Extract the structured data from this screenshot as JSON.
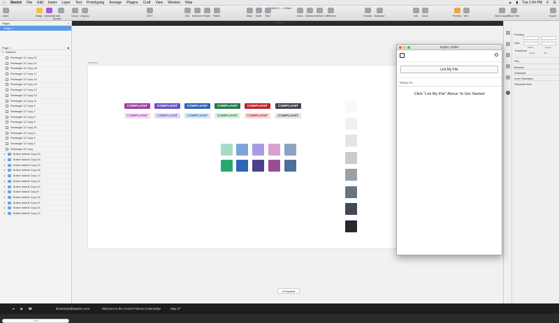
{
  "menubar": {
    "app": "Sketch",
    "items": [
      "File",
      "Edit",
      "Insert",
      "Layer",
      "Text",
      "Prototyping",
      "Arrange",
      "Plugins",
      "Craft",
      "View",
      "Window",
      "Help"
    ],
    "clock": "Tue 1:54 PM"
  },
  "toolbar": {
    "doc_title": "Untitled 6 — Edited",
    "items": [
      "Insert",
      "Shape",
      "Symbols",
      "Create Symbol",
      "Group",
      "Ungroup",
      "Zoom",
      "Edit",
      "Transform",
      "Rotate",
      "Flatten",
      "Mask",
      "Scale",
      "Slice",
      "Union",
      "Subtract",
      "Intersect",
      "Difference",
      "Forward",
      "Backward",
      "Link",
      "Cloud",
      "Preview",
      "View",
      "Show Layout",
      "Show Grid",
      "Export"
    ],
    "zoom": "124%"
  },
  "canvas_title": "Untitled 6",
  "pages": {
    "header": "Pages",
    "selected": "Page 1",
    "layers_header": "Page 1",
    "artboard": "Artboard",
    "layers": [
      "Rectangle 12 Copy 20",
      "Rectangle 12 Copy 19",
      "Rectangle 12 Copy 18",
      "Rectangle 12 Copy 17",
      "Rectangle 12 Copy 16",
      "Rectangle 12 Copy 15",
      "Rectangle 12 Copy 14",
      "Rectangle 12 Copy 13",
      "Rectangle 12 Copy 11",
      "Rectangle 12 Copy 9",
      "Rectangle 12 Copy 7",
      "Rectangle 12 Copy 5",
      "Rectangle 12 Copy 3",
      "Rectangle 12 Copy 10",
      "Rectangle 12 Copy 8",
      "Rectangle 12 Copy 6",
      "Rectangle 12 Copy 4",
      "Rectangle 12 Copy"
    ],
    "buttons": [
      "Button default Copy 23",
      "Button default Copy 24",
      "Button default Copy 19",
      "Button default Copy 18",
      "Button default Copy 17",
      "Button default Copy 16",
      "Button default Copy 10",
      "Button default Copy 8",
      "Button default Copy 15",
      "Button default Copy 21",
      "Button default Copy 20",
      "Button default Copy 14"
    ],
    "filter_placeholder": "Filter"
  },
  "artboard_label": "Artboard",
  "badges": {
    "label": "COMPLIANT",
    "solid": [
      "#a13ca6",
      "#6a4fc9",
      "#2b63b8",
      "#1f7a45",
      "#c41d2c",
      "#3f4650"
    ],
    "light_bg": [
      "#f0dcf1",
      "#e2dcf6",
      "#d9e6f6",
      "#d9efe1",
      "#f6dada",
      "#e2e5e8"
    ],
    "light_fg": [
      "#a13ca6",
      "#6a4fc9",
      "#2b63b8",
      "#1f7a45",
      "#c41d2c",
      "#3f4650"
    ]
  },
  "swatches": {
    "row1": [
      "#a6dcc5",
      "#7ea4d8",
      "#a99be2",
      "#d8a1cf",
      "#8ea3c1"
    ],
    "row2": [
      "#27a96e",
      "#2f64b6",
      "#4d3f8e",
      "#9a4d97",
      "#4e6f99"
    ]
  },
  "grays": [
    "#f7f8f8",
    "#eef1f0",
    "#e2e4e7",
    "#c8ccd1",
    "#9aa0a8",
    "#6b737c",
    "#424952",
    "#232a31"
  ],
  "inspector": {
    "position": "Position",
    "size": "Size",
    "transform": "Transform",
    "width": "Width",
    "height": "Height",
    "rotate": "Rotate",
    "flip": "Flip",
    "sections": [
      "Fills",
      "Borders",
      "Shadows",
      "Inner Shadows",
      "Gaussian Blur"
    ]
  },
  "plugin": {
    "title": "Toybox | Roller",
    "lint_button": "Lint My File",
    "results_label": "RESULTS:",
    "results_text": "Click \"Lint My File\" Above To Get Started"
  },
  "toast": "UI loaded!",
  "dock": {
    "email": "donotreply@wtpulse.com",
    "message": "Welcome to the Crunch Fitness Community!",
    "date": "May 27"
  }
}
